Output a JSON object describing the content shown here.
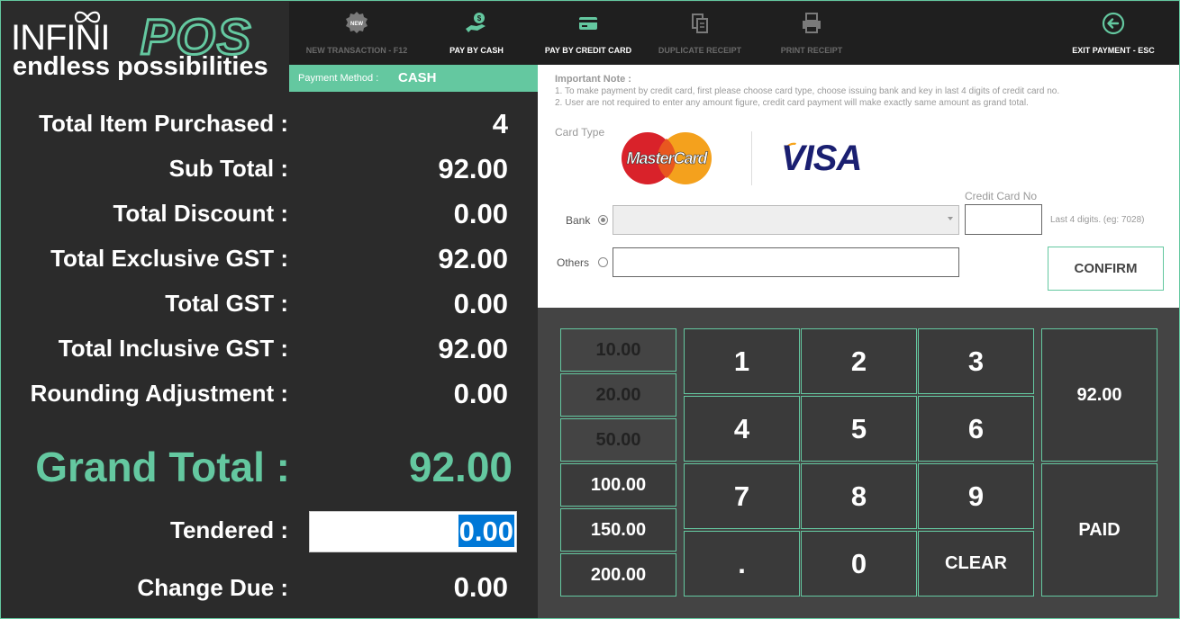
{
  "logo": {
    "brand": "INFINI",
    "brand_accent": "POS",
    "tagline": "endless possibilities"
  },
  "colors": {
    "accent": "#64c8a0",
    "toolbar_bg": "#1f1f1f",
    "panel_bg": "#2b2b2b",
    "keypad_bg": "#444444",
    "visa_blue": "#1a1f71"
  },
  "toolbar": [
    {
      "label": "NEW TRANSACTION - F12",
      "icon": "new-badge-icon",
      "enabled": false
    },
    {
      "label": "PAY BY CASH",
      "icon": "cash-hand-icon",
      "enabled": true
    },
    {
      "label": "PAY BY CREDIT CARD",
      "icon": "credit-card-icon",
      "enabled": true
    },
    {
      "label": "DUPLICATE RECEIPT",
      "icon": "duplicate-icon",
      "enabled": false
    },
    {
      "label": "PRINT RECEIPT",
      "icon": "printer-icon",
      "enabled": false
    },
    {
      "label": "EXIT PAYMENT - ESC",
      "icon": "back-arrow-circle-icon",
      "enabled": true
    }
  ],
  "payment_method": {
    "label": "Payment Method :",
    "value": "CASH"
  },
  "summary": {
    "rows": [
      {
        "label": "Total Item Purchased :",
        "value": "4"
      },
      {
        "label": "Sub Total :",
        "value": "92.00"
      },
      {
        "label": "Total Discount :",
        "value": "0.00"
      },
      {
        "label": "Total Exclusive GST :",
        "value": "92.00"
      },
      {
        "label": "Total GST :",
        "value": "0.00"
      },
      {
        "label": "Total Inclusive GST :",
        "value": "92.00"
      },
      {
        "label": "Rounding Adjustment :",
        "value": "0.00"
      }
    ],
    "grand_total": {
      "label": "Grand Total :",
      "value": "92.00"
    },
    "tendered": {
      "label": "Tendered :",
      "value": "0.00"
    },
    "change_due": {
      "label": "Change Due :",
      "value": "0.00"
    }
  },
  "card_panel": {
    "note_title": "Important Note :",
    "notes": [
      "1. To make payment by credit card, first please choose card type, choose issuing bank and key in last 4 digits of credit card no.",
      "2. User are not required to enter any amount figure, credit card payment will make exactly same amount as grand total."
    ],
    "card_type_label": "Card Type",
    "card_types": [
      "MasterCard",
      "VISA"
    ],
    "bank_label": "Bank",
    "bank_value": "",
    "cc_label": "Credit Card No",
    "cc_value": "",
    "cc_hint": "Last 4 digits. (eg: 7028)",
    "others_label": "Others",
    "others_value": "",
    "confirm_label": "CONFIRM"
  },
  "keypad": {
    "presets": [
      "10.00",
      "20.00",
      "50.00",
      "100.00",
      "150.00",
      "200.00"
    ],
    "digits": [
      "1",
      "2",
      "3",
      "4",
      "5",
      "6",
      "7",
      "8",
      "9",
      ".",
      "0",
      "CLEAR"
    ],
    "exact_amount": "92.00",
    "paid_label": "PAID"
  }
}
